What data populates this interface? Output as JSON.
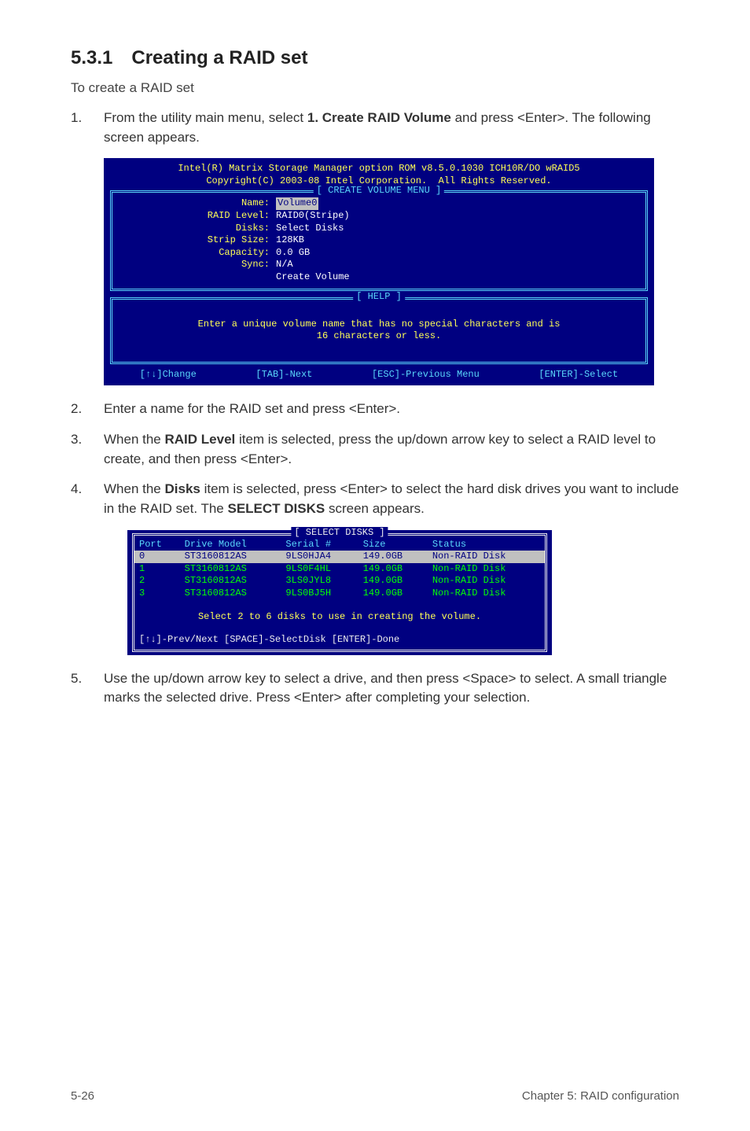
{
  "section_title": "5.3.1 Creating a RAID set",
  "intro": "To create a RAID set",
  "steps": {
    "s1_num": "1.",
    "s1_pre": "From the utility main menu, select ",
    "s1_bold": "1. Create RAID Volume",
    "s1_post": " and press <Enter>. The following screen appears.",
    "s2_num": "2.",
    "s2_text": "Enter a name for the RAID set and press <Enter>.",
    "s3_num": "3.",
    "s3_pre": "When the ",
    "s3_bold": "RAID Level",
    "s3_post": " item is selected, press the up/down arrow key to select a RAID level to create, and then press <Enter>.",
    "s4_num": "4.",
    "s4_pre": "When the ",
    "s4_bold1": "Disks",
    "s4_mid": " item is selected, press <Enter> to select the hard disk drives you want to include in the RAID set. The ",
    "s4_bold2": "SELECT DISKS",
    "s4_post": " screen appears.",
    "s5_num": "5.",
    "s5_text": "Use the up/down arrow key to select a drive, and then press <Space> to select. A small triangle marks the selected drive. Press <Enter> after completing your selection."
  },
  "bios1": {
    "header1": "Intel(R) Matrix Storage Manager option ROM v8.5.0.1030 ICH10R/DO wRAID5",
    "header2": "Copyright(C) 2003-08 Intel Corporation.  All Rights Reserved.",
    "frame1_title": "[ CREATE VOLUME MENU ]",
    "form": [
      {
        "label": "Name:",
        "value": "Volume0",
        "hilite": true
      },
      {
        "label": "RAID Level:",
        "value": "RAID0(Stripe)"
      },
      {
        "label": "Disks:",
        "value": "Select Disks"
      },
      {
        "label": "Strip Size:",
        "value": "128KB"
      },
      {
        "label": "Capacity:",
        "value": "0.0   GB"
      },
      {
        "label": "Sync:",
        "value": "N/A"
      },
      {
        "label": "",
        "value": "Create Volume"
      }
    ],
    "frame2_title": "[ HELP ]",
    "help_text": "Enter a unique volume name that has no special characters and is\n16 characters or less.",
    "footer": {
      "f1": "[↑↓]Change",
      "f2": "[TAB]-Next",
      "f3": "[ESC]-Previous Menu",
      "f4": "[ENTER]-Select"
    }
  },
  "bios2": {
    "title": "[ SELECT DISKS ]",
    "headers": {
      "port": "Port",
      "model": "Drive Model",
      "serial": "Serial #",
      "size": "Size",
      "status": "Status"
    },
    "rows": [
      {
        "port": "0",
        "model": "ST3160812AS",
        "serial": "9LS0HJA4",
        "size": "149.0GB",
        "status": "Non-RAID Disk",
        "sel": true
      },
      {
        "port": "1",
        "model": "ST3160812AS",
        "serial": "9LS0F4HL",
        "size": "149.0GB",
        "status": "Non-RAID Disk"
      },
      {
        "port": "2",
        "model": "ST3160812AS",
        "serial": "3LS0JYL8",
        "size": "149.0GB",
        "status": "Non-RAID Disk"
      },
      {
        "port": "3",
        "model": "ST3160812AS",
        "serial": "9LS0BJ5H",
        "size": "149.0GB",
        "status": "Non-RAID Disk"
      }
    ],
    "msg": "Select 2 to 6 disks to use in creating the volume.",
    "foot": "[↑↓]-Prev/Next [SPACE]-SelectDisk [ENTER]-Done"
  },
  "footer": {
    "left": "5-26",
    "right": "Chapter 5: RAID configuration"
  }
}
